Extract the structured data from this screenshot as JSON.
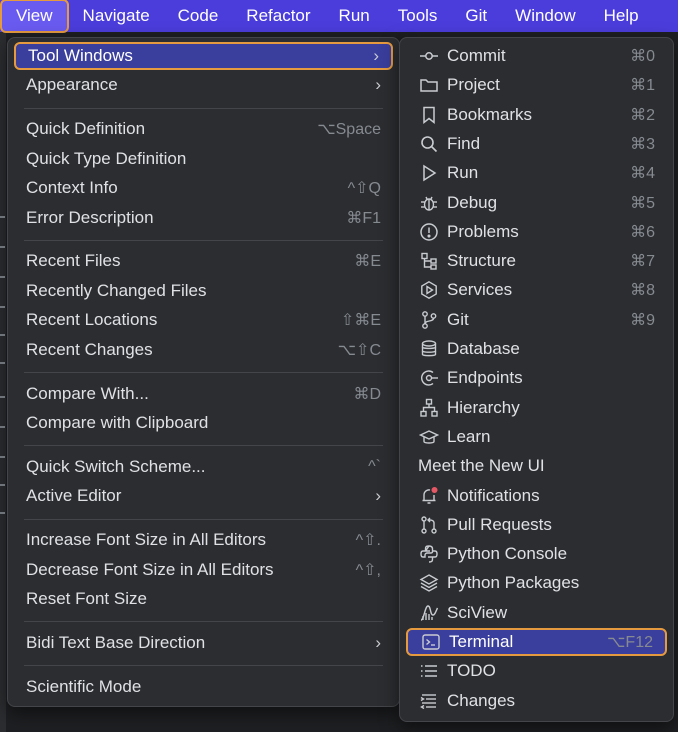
{
  "menubar": {
    "items": [
      "View",
      "Navigate",
      "Code",
      "Refactor",
      "Run",
      "Tools",
      "Git",
      "Window",
      "Help"
    ]
  },
  "view_menu": {
    "groups": [
      [
        {
          "label": "Tool Windows",
          "shortcut": "",
          "submenu": true,
          "highlighted": true
        },
        {
          "label": "Appearance",
          "shortcut": "",
          "submenu": true
        }
      ],
      [
        {
          "label": "Quick Definition",
          "shortcut": "⌥Space"
        },
        {
          "label": "Quick Type Definition",
          "shortcut": ""
        },
        {
          "label": "Context Info",
          "shortcut": "^⇧Q"
        },
        {
          "label": "Error Description",
          "shortcut": "⌘F1"
        }
      ],
      [
        {
          "label": "Recent Files",
          "shortcut": "⌘E"
        },
        {
          "label": "Recently Changed Files",
          "shortcut": ""
        },
        {
          "label": "Recent Locations",
          "shortcut": "⇧⌘E"
        },
        {
          "label": "Recent Changes",
          "shortcut": "⌥⇧C"
        }
      ],
      [
        {
          "label": "Compare With...",
          "shortcut": "⌘D"
        },
        {
          "label": "Compare with Clipboard",
          "shortcut": ""
        }
      ],
      [
        {
          "label": "Quick Switch Scheme...",
          "shortcut": "^`"
        },
        {
          "label": "Active Editor",
          "shortcut": "",
          "submenu": true
        }
      ],
      [
        {
          "label": "Increase Font Size in All Editors",
          "shortcut": "^⇧."
        },
        {
          "label": "Decrease Font Size in All Editors",
          "shortcut": "^⇧,"
        },
        {
          "label": "Reset Font Size",
          "shortcut": ""
        }
      ],
      [
        {
          "label": "Bidi Text Base Direction",
          "shortcut": "",
          "submenu": true
        }
      ],
      [
        {
          "label": "Scientific Mode",
          "shortcut": ""
        }
      ]
    ]
  },
  "tool_windows_menu": {
    "items": [
      {
        "label": "Commit",
        "shortcut": "⌘0",
        "icon": "commit-icon"
      },
      {
        "label": "Project",
        "shortcut": "⌘1",
        "icon": "folder-icon"
      },
      {
        "label": "Bookmarks",
        "shortcut": "⌘2",
        "icon": "bookmark-icon"
      },
      {
        "label": "Find",
        "shortcut": "⌘3",
        "icon": "search-icon"
      },
      {
        "label": "Run",
        "shortcut": "⌘4",
        "icon": "run-icon"
      },
      {
        "label": "Debug",
        "shortcut": "⌘5",
        "icon": "bug-icon"
      },
      {
        "label": "Problems",
        "shortcut": "⌘6",
        "icon": "problems-icon"
      },
      {
        "label": "Structure",
        "shortcut": "⌘7",
        "icon": "structure-icon"
      },
      {
        "label": "Services",
        "shortcut": "⌘8",
        "icon": "services-icon"
      },
      {
        "label": "Git",
        "shortcut": "⌘9",
        "icon": "git-branch-icon"
      },
      {
        "label": "Database",
        "shortcut": "",
        "icon": "database-icon"
      },
      {
        "label": "Endpoints",
        "shortcut": "",
        "icon": "endpoints-icon"
      },
      {
        "label": "Hierarchy",
        "shortcut": "",
        "icon": "hierarchy-icon"
      },
      {
        "label": "Learn",
        "shortcut": "",
        "icon": "learn-icon"
      },
      {
        "label": "Meet the New UI",
        "shortcut": "",
        "icon": ""
      },
      {
        "label": "Notifications",
        "shortcut": "",
        "icon": "bell-icon"
      },
      {
        "label": "Pull Requests",
        "shortcut": "",
        "icon": "pull-request-icon"
      },
      {
        "label": "Python Console",
        "shortcut": "",
        "icon": "python-icon"
      },
      {
        "label": "Python Packages",
        "shortcut": "",
        "icon": "layers-icon"
      },
      {
        "label": "SciView",
        "shortcut": "",
        "icon": "sciview-icon"
      },
      {
        "label": "Terminal",
        "shortcut": "⌥F12",
        "icon": "terminal-icon",
        "highlighted": true
      },
      {
        "label": "TODO",
        "shortcut": "",
        "icon": "todo-icon"
      },
      {
        "label": "Changes",
        "shortcut": "",
        "icon": "changes-icon"
      }
    ]
  },
  "colors": {
    "menubar_bg": "#4b3ddb",
    "menu_bg": "#2b2d30",
    "highlight_bg": "#3a3e9c",
    "focus_outline": "#e59a3f",
    "notification_dot": "#e55765"
  }
}
